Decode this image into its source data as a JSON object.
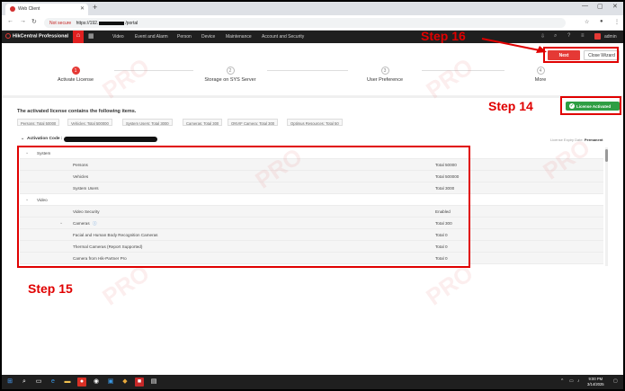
{
  "browser": {
    "tab_title": "Web Client",
    "url_security": "Not secure",
    "url_prefix": "https://192.",
    "url_suffix": "/portal"
  },
  "app": {
    "brand": "HikCentral Professional",
    "menu": [
      "Video",
      "Event and Alarm",
      "Person",
      "Device",
      "Maintenance",
      "Account and Security"
    ],
    "user": "admin"
  },
  "wizard": {
    "steps": [
      {
        "num": "1",
        "label": "Activate License"
      },
      {
        "num": "2",
        "label": "Storage on SYS Server"
      },
      {
        "num": "3",
        "label": "User Preference"
      },
      {
        "num": "4",
        "label": "More"
      }
    ],
    "next_label": "Next",
    "close_label": "Close Wizard"
  },
  "license": {
    "activated_badge": "License Activated",
    "section_title": "The activated license contains the following items.",
    "chips": [
      "Persons: Total 50000",
      "Vehicles: Total 500000",
      "System Users: Total 3000",
      "Cameras: Total 300",
      "ONVIF Camera: Total 300",
      "Optimus Resources: Total 50"
    ],
    "activation_code_label": "Activation Code :",
    "expiry_label": "License Expiry Date:",
    "expiry_value": "Permanent",
    "rows": [
      {
        "type": "group",
        "label": "System",
        "value": ""
      },
      {
        "type": "item",
        "label": "Persons",
        "value": "Total 50000"
      },
      {
        "type": "item",
        "label": "Vehicles",
        "value": "Total 500000"
      },
      {
        "type": "item",
        "label": "System Users",
        "value": "Total 3000"
      },
      {
        "type": "group",
        "label": "Video",
        "value": ""
      },
      {
        "type": "item",
        "label": "Video Security",
        "value": "Enabled"
      },
      {
        "type": "sub",
        "label": "Cameras",
        "value": "Total 300"
      },
      {
        "type": "item",
        "label": "Facial and Human Body Recognition Cameras",
        "value": "Total 0"
      },
      {
        "type": "item",
        "label": "Thermal Cameras (Report Supported)",
        "value": "Total 0"
      },
      {
        "type": "item",
        "label": "Camera from Hik-Partner Pro",
        "value": "Total 0"
      }
    ]
  },
  "annotations": {
    "step16": "Step 16",
    "step14": "Step 14",
    "step15": "Step 15",
    "color": "#e00000"
  },
  "taskbar": {
    "time": "9:00 PM",
    "date": "3/14/2025"
  }
}
